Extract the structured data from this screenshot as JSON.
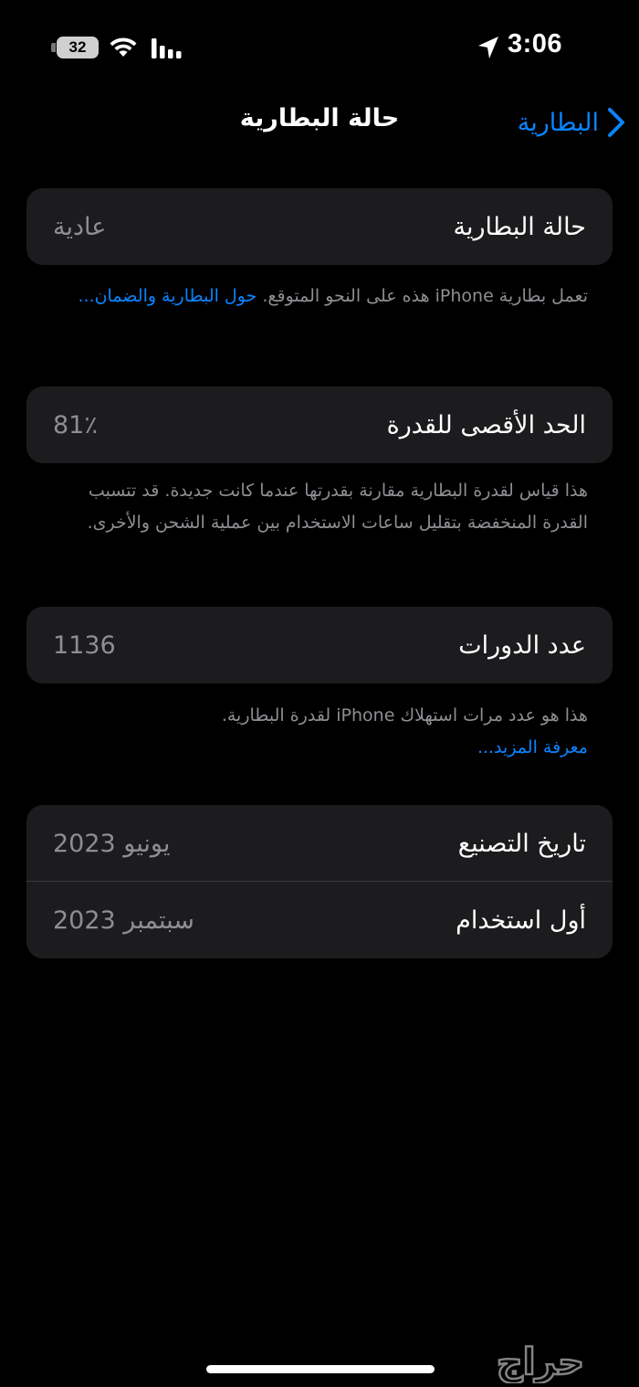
{
  "status_bar": {
    "time": "3:06",
    "battery_level": "32"
  },
  "nav": {
    "title": "حالة البطارية",
    "back_label": "البطارية"
  },
  "sections": {
    "health": {
      "label": "حالة البطارية",
      "value": "عادية",
      "footer_text": "تعمل بطارية iPhone هذه على النحو المتوقع. ",
      "footer_link": "حول البطارية والضمان..."
    },
    "max_capacity": {
      "label": "الحد الأقصى للقدرة",
      "value": "81٪",
      "footer_text": "هذا قياس لقدرة البطارية مقارنة بقدرتها عندما كانت جديدة. قد تتسبب القدرة المنخفضة بتقليل ساعات الاستخدام بين عملية الشحن والأخرى."
    },
    "cycle_count": {
      "label": "عدد الدورات",
      "value": "1136",
      "footer_text": "هذا هو عدد مرات استهلاك iPhone لقدرة البطارية.",
      "footer_link": "معرفة المزيد..."
    },
    "dates": {
      "manufacture_label": "تاريخ التصنيع",
      "manufacture_value": "يونيو 2023",
      "first_use_label": "أول استخدام",
      "first_use_value": "سبتمبر 2023"
    }
  },
  "watermark": "حراج",
  "colors": {
    "background": "#000000",
    "cell": "#1c1c1e",
    "accent": "#0a84ff",
    "secondary_text": "#8e8e93"
  }
}
